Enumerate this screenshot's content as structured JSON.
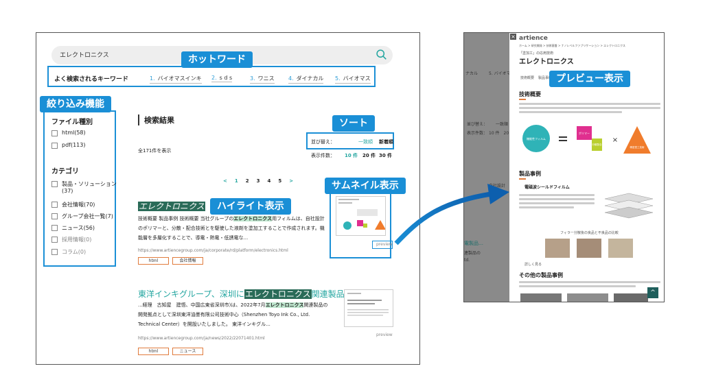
{
  "callouts": {
    "hot_word": "ホットワード",
    "filter": "絞り込み機能",
    "sort": "ソート",
    "thumbnail": "サムネイル表示",
    "highlight": "ハイライト表示",
    "preview": "プレビュー表示"
  },
  "search": {
    "value": "エレクトロニクス"
  },
  "keywords": {
    "label": "よく検索されるキーワード",
    "items": [
      {
        "num": "1.",
        "label": "バイオマスインキ"
      },
      {
        "num": "2.",
        "label": "s d s"
      },
      {
        "num": "3.",
        "label": "ワニス"
      },
      {
        "num": "4.",
        "label": "ダイナカル"
      },
      {
        "num": "5.",
        "label": "バイオマス"
      }
    ]
  },
  "filters": {
    "file_type_title": "ファイル種別",
    "file_types": [
      {
        "label": "html(58)"
      },
      {
        "label": "pdf(113)"
      }
    ],
    "category_title": "カテゴリ",
    "categories": [
      {
        "label": "製品・ソリューション",
        "count": "(37)"
      },
      {
        "label": "会社情報(70)"
      },
      {
        "label": "グループ会社一覧(7)"
      },
      {
        "label": "ニュース(56)"
      },
      {
        "label": "採用情報(0)"
      },
      {
        "label": "コラム(0)"
      }
    ]
  },
  "results": {
    "title": "検索結果",
    "count": "全171件を表示",
    "sort_label": "並び替え：",
    "sort_options": [
      "一致順",
      "新着順"
    ],
    "size_label": "表示件数：",
    "size_options": [
      "10 件",
      "20 件",
      "30 件"
    ],
    "pager": [
      "<",
      "1",
      "2",
      "3",
      "4",
      "5",
      ">"
    ],
    "items": [
      {
        "title_hl": "エレクトロニクス",
        "body_1a": "技術概要 製品事例 技術概要 当社グループの",
        "body_1hl": "エレクトロニクス",
        "body_1b": "用フィルムは、自社設計",
        "body_2": "のポリマーと、分散・配合技術とを駆使した液剤を塗加工することで作成されます。機",
        "body_3": "能層を多層化することで、導電・熱電・低誘電な...",
        "url": "https://www.artiencegroup.com/ja/corporate/rd/platform/electronics.html",
        "tags": [
          "html",
          "会社情報"
        ],
        "preview": "preview"
      },
      {
        "title_a": "東洋インキグループ、深圳に",
        "title_hl": "エレクトロニクス",
        "title_b": "関連製品…",
        "body_1a": "...経理　古知屋　建悟、中国広東省深圳市)は、2022年7月",
        "body_1hl": "エレクトロニクス",
        "body_1b": "関連製品の",
        "body_2": "開発拠点として深圳東洋油墨有限公司技術中心（Shenzhen Toyo Ink Co., Ltd.",
        "body_3": "Technical Center）を開設いたしました。 東洋インキグル...",
        "url": "https://www.artiencegroup.com/ja/news/2022/22071401.html",
        "tags": [
          "html",
          "ニュース"
        ],
        "preview": "preview"
      }
    ]
  },
  "preview_panel": {
    "logo": "artience",
    "close": "×",
    "breadcrumb": "ホーム > 研究開発 > 技術基盤 > ナノレベルファブリケーション > エレクトロニクス",
    "kicker": "「塗加工」の応用技術",
    "title": "エレクトロニクス",
    "nav_1": "技術概要",
    "nav_2": "製品事例",
    "section_1": "技術概要",
    "diagram_left": "機能性フィルム",
    "diagram_mid_1": "ポリマー",
    "diagram_mid_2": "分散配合",
    "diagram_right": "精密塗工技術",
    "section_2": "製品事例",
    "sub_1": "電磁波シールドフィルム",
    "sub_caption": "フィラー分散後の良品と不良品の比較",
    "link": "詳しく見る",
    "section_3": "その他の製品事例",
    "bg_1": "ナカル",
    "bg_2": "5. バイオマス",
    "bg_3": "並び替え：",
    "bg_3b": "一致順",
    "bg_4": "表示件数：",
    "bg_4b": "10 件　20",
    "bg_5": "自社設計",
    "bg_6": "電製品…",
    "bg_7": "連製品の",
    "bg_8": "td."
  },
  "colors": {
    "accent": "#1a8fd6",
    "teal": "#24a6a0",
    "tag_border": "#e07b3c",
    "highlight": "#2a6b58"
  }
}
